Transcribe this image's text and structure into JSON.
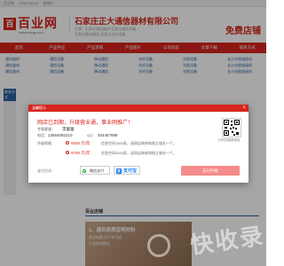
{
  "topbar": {
    "items": [
      "百业网",
      "2015-08-18",
      "星期二"
    ],
    "right": ""
  },
  "header": {
    "logo_mark": "百",
    "logo_cn": "百业网",
    "logo_en": "baiyewang.com",
    "company": "石家庄正大通信器材有限公司",
    "company_sub": "主营：石家庄通信器材 石家庄通信设备",
    "company_sub2": "石家庄移动通信 石家庄光纤设备",
    "free_shop": "免费店铺"
  },
  "nav": [
    "首页",
    "产品供应",
    "产品求购",
    "产品图片",
    "公司动态",
    "文章下载",
    "联系方式"
  ],
  "rows": [
    [
      "通信器材",
      "通信设备",
      "移动通信",
      "光纤设备",
      "光缆设备",
      "长沙光缆熔接机"
    ],
    [
      "通信器材",
      "通信设备",
      "移动通信",
      "光纤设备",
      "光缆设备",
      "长沙光缆熔接机"
    ],
    [
      "通信器材",
      "通信设备",
      "移动通信",
      "光纤设备",
      "光缆设备",
      "长沙光缆熔接机"
    ]
  ],
  "left_section": {
    "title": "联系方式"
  },
  "lower": {
    "title": "百业店铺",
    "banner_title": "1、通讯资质证明材料",
    "banner_sub": "营业执照 开户许可证",
    "banner_sub2": "产品检测报告"
  },
  "modal": {
    "head": "温馨提示",
    "close": "×",
    "title": "网店已到期，升级营业通，事业网推广！",
    "contact_label": "专属客服：",
    "contact_name": "李蕾蕾",
    "phone_label": "电话：",
    "phone": "13554082210",
    "qq_label": "QQ：",
    "qq": "454457688",
    "qr_caption": "扫码加客服微信",
    "upgrade_label": "升级规格：",
    "opt1_price": "¥300 元/年",
    "opt1_desc": "信息空间1500条，送网店装修和独立域名一个。",
    "opt2_price": "¥700 元/年",
    "opt2_desc": "信息空间3000条，送网店装修和独立域名一个。",
    "pay_label": "支付方式：",
    "wechat": "微信支付",
    "alipay": "支付宝",
    "confirm": "支付升级"
  },
  "watermark": "快收录"
}
